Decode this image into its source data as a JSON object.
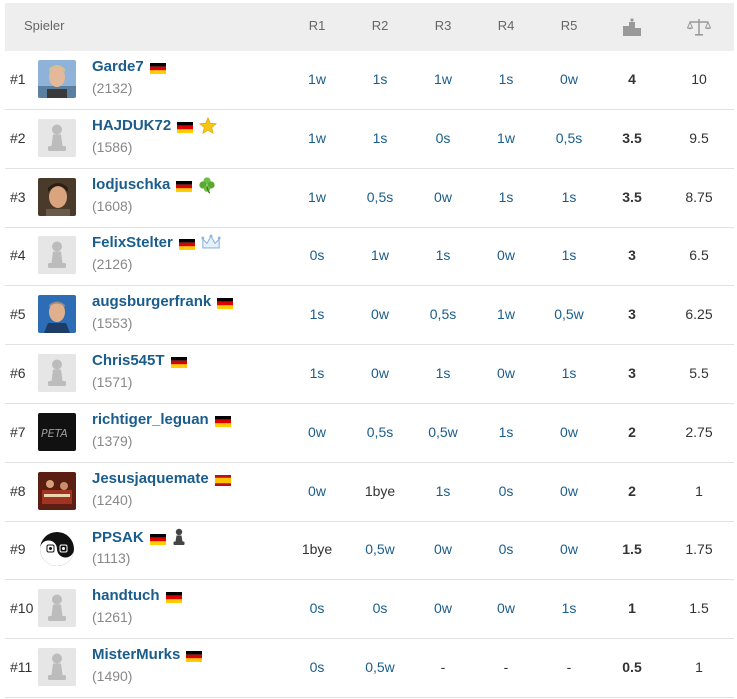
{
  "header": {
    "player_label": "Spieler",
    "rounds": [
      "R1",
      "R2",
      "R3",
      "R4",
      "R5"
    ],
    "points_icon": "podium-icon",
    "tiebreak_icon": "scales-icon"
  },
  "colors": {
    "link": "#1a5d8c",
    "header_bg": "#eeeeee",
    "row_border": "#e2e2e2"
  },
  "players": [
    {
      "rank": "#1",
      "name": "Garde7",
      "rating": "(2132)",
      "flag": "de",
      "badge": "",
      "avatar": "photo-blond",
      "results": [
        "1w",
        "1s",
        "1w",
        "1s",
        "0w"
      ],
      "points": "4",
      "tiebreak": "10"
    },
    {
      "rank": "#2",
      "name": "HAJDUK72",
      "rating": "(1586)",
      "flag": "de",
      "badge": "star-icon",
      "avatar": "pawn",
      "results": [
        "1w",
        "1s",
        "0s",
        "1w",
        "0,5s"
      ],
      "points": "3.5",
      "tiebreak": "9.5"
    },
    {
      "rank": "#3",
      "name": "lodjuschka",
      "rating": "(1608)",
      "flag": "de",
      "badge": "clover-icon",
      "avatar": "photo-man",
      "results": [
        "1w",
        "0,5s",
        "0w",
        "1s",
        "1s"
      ],
      "points": "3.5",
      "tiebreak": "8.75"
    },
    {
      "rank": "#4",
      "name": "FelixStelter",
      "rating": "(2126)",
      "flag": "de",
      "badge": "crown-icon",
      "avatar": "pawn",
      "results": [
        "0s",
        "1w",
        "1s",
        "0w",
        "1s"
      ],
      "points": "3",
      "tiebreak": "6.5"
    },
    {
      "rank": "#5",
      "name": "augsburgerfrank",
      "rating": "(1553)",
      "flag": "de",
      "badge": "",
      "avatar": "photo-blue",
      "results": [
        "1s",
        "0w",
        "0,5s",
        "1w",
        "0,5w"
      ],
      "points": "3",
      "tiebreak": "6.25"
    },
    {
      "rank": "#6",
      "name": "Chris545T",
      "rating": "(1571)",
      "flag": "de",
      "badge": "",
      "avatar": "pawn",
      "results": [
        "1s",
        "0w",
        "1s",
        "0w",
        "1s"
      ],
      "points": "3",
      "tiebreak": "5.5"
    },
    {
      "rank": "#7",
      "name": "richtiger_leguan",
      "rating": "(1379)",
      "flag": "de",
      "badge": "",
      "avatar": "photo-dark",
      "results": [
        "0w",
        "0,5s",
        "0,5w",
        "1s",
        "0w"
      ],
      "points": "2",
      "tiebreak": "2.75"
    },
    {
      "rank": "#8",
      "name": "Jesusjaquemate",
      "rating": "(1240)",
      "flag": "es",
      "badge": "",
      "avatar": "photo-red",
      "results": [
        "0w",
        "1bye",
        "1s",
        "0s",
        "0w"
      ],
      "points": "2",
      "tiebreak": "1"
    },
    {
      "rank": "#9",
      "name": "PPSAK",
      "rating": "(1113)",
      "flag": "de",
      "badge": "pawn-badge-icon",
      "avatar": "yinyang",
      "results": [
        "1bye",
        "0,5w",
        "0w",
        "0s",
        "0w"
      ],
      "points": "1.5",
      "tiebreak": "1.75"
    },
    {
      "rank": "#10",
      "name": "handtuch",
      "rating": "(1261)",
      "flag": "de",
      "badge": "",
      "avatar": "pawn",
      "results": [
        "0s",
        "0s",
        "0w",
        "0w",
        "1s"
      ],
      "points": "1",
      "tiebreak": "1.5"
    },
    {
      "rank": "#11",
      "name": "MisterMurks",
      "rating": "(1490)",
      "flag": "de",
      "badge": "",
      "avatar": "pawn",
      "results": [
        "0s",
        "0,5w",
        "-",
        "-",
        "-"
      ],
      "points": "0.5",
      "tiebreak": "1"
    }
  ]
}
